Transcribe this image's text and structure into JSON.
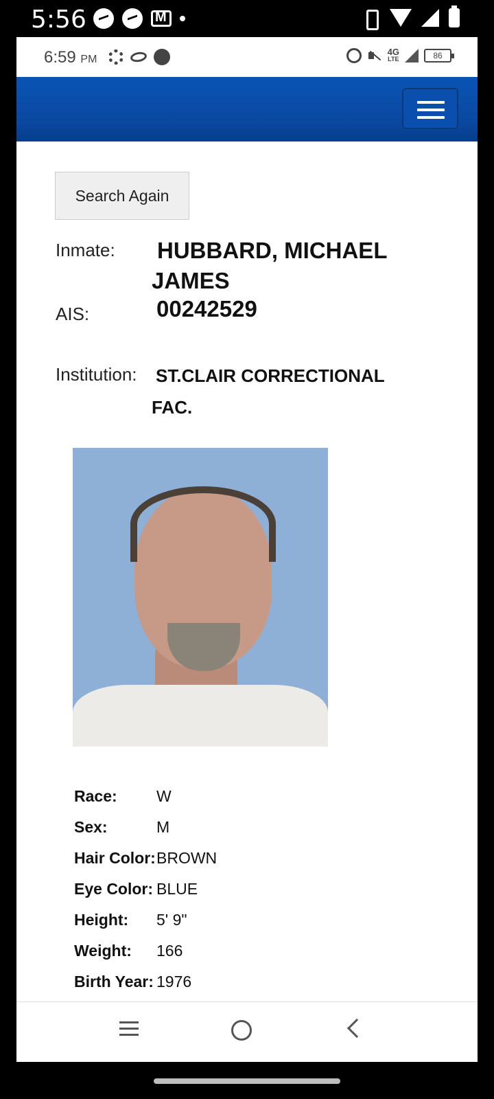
{
  "device_status": {
    "time": "5:56"
  },
  "app_status": {
    "time": "6:59",
    "ampm": "PM",
    "network": "4G",
    "network_sub": "LTE",
    "battery": "86"
  },
  "header": {
    "menu_icon": "hamburger-menu-icon"
  },
  "search_again_label": "Search Again",
  "inmate": {
    "label": "Inmate:",
    "name": "HUBBARD, MICHAEL JAMES",
    "ais_label": "AIS:",
    "ais": "00242529",
    "institution_label": "Institution:",
    "institution": "ST.CLAIR CORRECTIONAL FAC."
  },
  "details": [
    {
      "label": "Race:",
      "value": "W"
    },
    {
      "label": "Sex:",
      "value": "M"
    },
    {
      "label": "Hair Color:",
      "value": "BROWN"
    },
    {
      "label": "Eye Color:",
      "value": "BLUE"
    },
    {
      "label": "Height:",
      "value": "5' 9\""
    },
    {
      "label": "Weight:",
      "value": "166"
    },
    {
      "label": "Birth Year:",
      "value": "1976"
    }
  ],
  "colors": {
    "header_blue": "#0a4fa8",
    "photo_background": "#8eb0d6"
  }
}
